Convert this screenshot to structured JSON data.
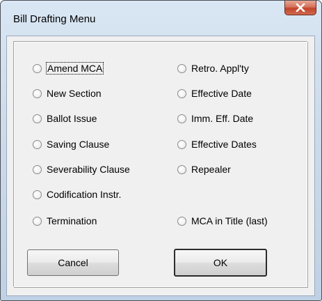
{
  "window": {
    "title": "Bill Drafting Menu"
  },
  "options_left": [
    {
      "label": "Amend MCA"
    },
    {
      "label": "New Section"
    },
    {
      "label": "Ballot Issue"
    },
    {
      "label": "Saving Clause"
    },
    {
      "label": "Severability Clause"
    },
    {
      "label": "Codification Instr."
    },
    {
      "label": "Termination"
    }
  ],
  "options_right": [
    {
      "label": "Retro. Appl'ty"
    },
    {
      "label": "Effective Date"
    },
    {
      "label": "Imm. Eff. Date"
    },
    {
      "label": "Effective Dates"
    },
    {
      "label": "Repealer"
    },
    {
      "label": "MCA in Title (last)"
    }
  ],
  "buttons": {
    "cancel_label": "Cancel",
    "ok_label": "OK"
  },
  "icons": {
    "close": "close-icon",
    "radio": "radio-button-icon"
  },
  "colors": {
    "close_button": "#c2432a",
    "dialog_background": "#f0f0f0"
  }
}
